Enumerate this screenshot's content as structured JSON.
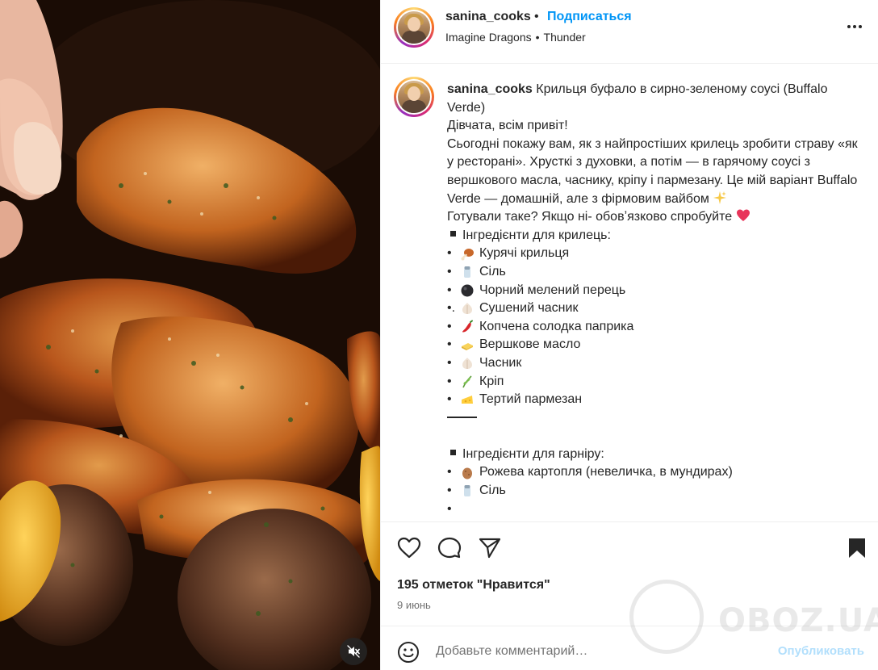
{
  "header": {
    "username": "sanina_cooks",
    "separator": "•",
    "follow_label": "Подписаться",
    "music_artist": "Imagine Dragons",
    "music_dot": "•",
    "music_track": "Thunder",
    "more_icon": "more-horizontal-icon"
  },
  "caption": {
    "username": "sanina_cooks",
    "title": " Крильця буфало в сирно-зеленому соусі (Buffalo Verde)",
    "greeting": "Дівчата, всім привіт!",
    "intro": "Сьогодні покажу вам, як з найпростіших крилець зробити страву «як у ресторані». Хрусткі з духовки, а потім — в гарячому соусі з вершкового масла, часнику, кріпу і пармезану. Це мій варіант Buffalo Verde — домашній, але з фірмовим вайбом",
    "question": "Готували таке? Якщо ні- обовʼязково спробуйте",
    "section1": "Інгредієнти для крилець:",
    "items1": [
      {
        "bullet": "•",
        "emoji": "poultry-leg",
        "text": "Курячі крильця"
      },
      {
        "bullet": "•",
        "emoji": "salt-shaker",
        "text": "Сіль"
      },
      {
        "bullet": "•",
        "emoji": "black-circle",
        "text": "Чорний мелений перець"
      },
      {
        "bullet": "•.",
        "emoji": "garlic",
        "text": " Сушений часник"
      },
      {
        "bullet": "•",
        "emoji": "hot-pepper",
        "text": "Копчена солодка паприка"
      },
      {
        "bullet": "•",
        "emoji": "butter",
        "text": "Вершкове масло"
      },
      {
        "bullet": "•",
        "emoji": "garlic",
        "text": "Часник"
      },
      {
        "bullet": "•",
        "emoji": "herb",
        "text": "Кріп"
      },
      {
        "bullet": "•",
        "emoji": "cheese",
        "text": "Тертий пармезан"
      }
    ],
    "section2": "Інгредієнти для гарніру:",
    "items2": [
      {
        "bullet": "•",
        "emoji": "potato",
        "text": "Рожева картопля (невеличка, в мундирах)"
      },
      {
        "bullet": "•",
        "emoji": "salt-shaker",
        "text": "Сіль"
      }
    ]
  },
  "actions": {
    "like_icon": "heart-icon",
    "comment_icon": "comment-icon",
    "share_icon": "send-icon",
    "save_icon": "bookmark-icon",
    "likes_text": "195 отметок \"Нравится\"",
    "date": "9 июнь"
  },
  "comment": {
    "placeholder": "Добавьте комментарий…",
    "publish_label": "Опубликовать"
  },
  "media": {
    "mute_icon": "muted-speaker-icon"
  },
  "watermark": {
    "text": "OBOZ.UA"
  },
  "colors": {
    "accent": "#0095f6",
    "publish_disabled": "#b2dffc",
    "heart": "#ed4956"
  }
}
